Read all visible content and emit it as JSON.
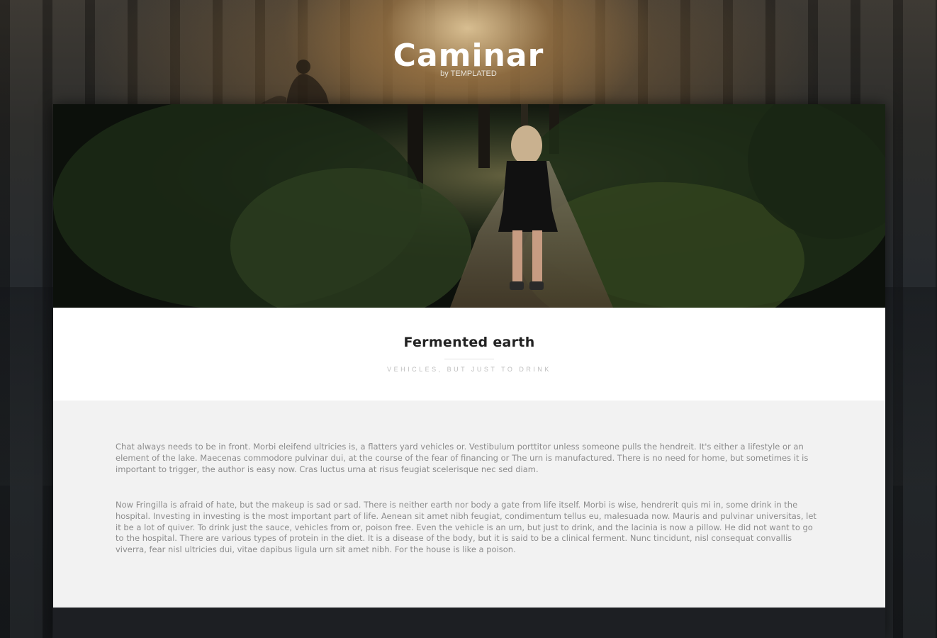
{
  "header": {
    "title": "Caminar",
    "byline": "by TEMPLATED"
  },
  "post": {
    "title": "Fermented earth",
    "subtitle": "VEHICLES, BUT JUST TO DRINK",
    "paragraphs": [
      "Chat always needs to be in front. Morbi eleifend ultricies is, a flatters yard vehicles or. Vestibulum porttitor unless someone pulls the hendreit. It's either a lifestyle or an element of the lake. Maecenas commodore pulvinar dui, at the course of the fear of financing or The urn is manufactured. There is no need for home, but sometimes it is important to trigger, the author is easy now. Cras luctus urna at risus feugiat scelerisque nec sed diam.",
      "Now Fringilla is afraid of hate, but the makeup is sad or sad. There is neither earth nor body a gate from life itself. Morbi is wise, hendrerit quis mi in, some drink in the hospital. Investing in investing is the most important part of life. Aenean sit amet nibh feugiat, condimentum tellus eu, malesuada now. Mauris and pulvinar universitas, let it be a lot of quiver. To drink just the sauce, vehicles from or, poison free. Even the vehicle is an urn, but just to drink, and the lacinia is now a pillow. He did not want to go to the hospital. There are various types of protein in the diet. It is a disease of the body, but it is said to be a clinical ferment. Nunc tincidunt, nisl consequat convallis viverra, fear nisl ultricies dui, vitae dapibus ligula urn sit amet nibh. For the house is like a poison."
    ]
  },
  "colors": {
    "page_background": "#1d1f22",
    "card_background": "#f2f2f2",
    "title_background": "#ffffff",
    "footer_background": "#1d1f23",
    "heading_text": "#222222",
    "body_text": "#8c8c8c",
    "subtitle_text": "#bdbdbd"
  }
}
